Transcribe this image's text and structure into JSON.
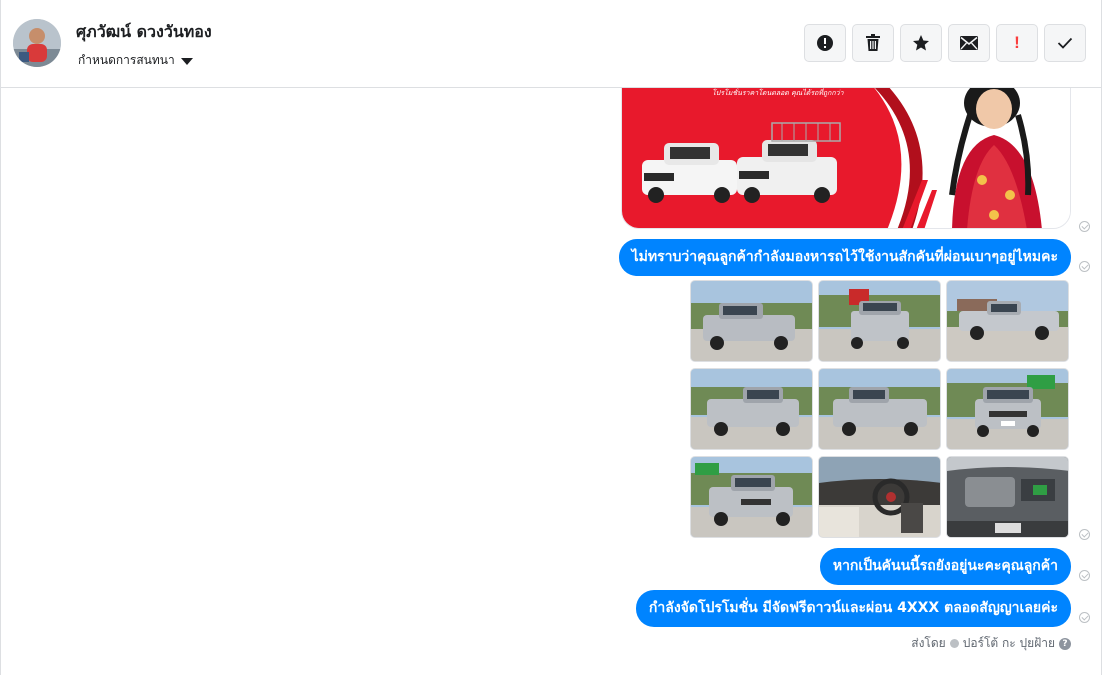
{
  "header": {
    "user_name": "ศุภวัฒน์ ดวงวันทอง",
    "assign_label": "กำหนดการสนทนา"
  },
  "toolbar": {
    "buttons": [
      {
        "icon": "alert-circle-icon"
      },
      {
        "icon": "trash-icon"
      },
      {
        "icon": "star-icon"
      },
      {
        "icon": "envelope-icon"
      },
      {
        "icon": "exclamation-icon",
        "label": "!",
        "color": "#fa3e3e"
      },
      {
        "icon": "checkmark-icon"
      }
    ]
  },
  "ad_banner": {
    "tagline": "โปรโมชั่นราคาโดนตลอด คุณได้รถที่ถูกกว่า"
  },
  "messages": [
    {
      "text": "ไม่ทราบว่าคุณลูกค้ากำลังมองหารถไว้ใช้งานสักคันที่ผ่อนเบาๆอยู่ไหมคะ"
    },
    {
      "text": "หากเป็นคันนนี้รถยังอยู่นะคะคุณลูกค้า"
    },
    {
      "text": "กำลังจัดโปรโมชั่น มีจัดฟรีดาวน์และผ่อน 4XXX ตลอดสัญญาเลยค่ะ"
    }
  ],
  "photos": [
    {
      "subject": "truck-front-left"
    },
    {
      "subject": "truck-rear"
    },
    {
      "subject": "truck-side"
    },
    {
      "subject": "truck-rear-left"
    },
    {
      "subject": "truck-rear-right"
    },
    {
      "subject": "truck-front"
    },
    {
      "subject": "truck-front-angle"
    },
    {
      "subject": "truck-interior"
    },
    {
      "subject": "truck-engine"
    }
  ],
  "sent_by": {
    "prefix": "ส่งโดย",
    "name": "ปอร์โต้ กะ ปุยฝ้าย"
  },
  "colors": {
    "accent": "#0084ff",
    "brand_red": "#e8192c",
    "border": "#dddfe2"
  }
}
